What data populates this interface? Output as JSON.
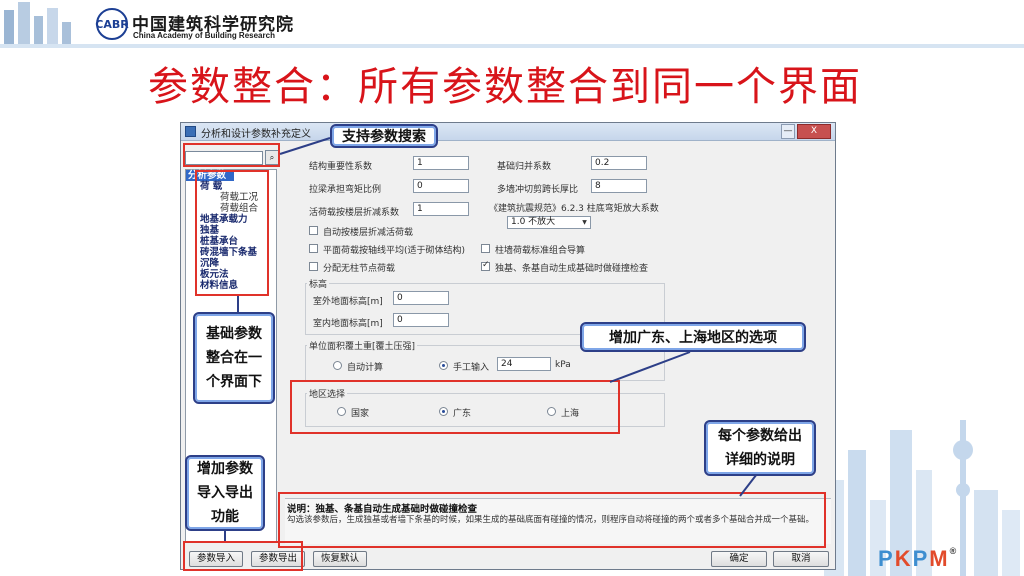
{
  "slide": {
    "org_cn": "中国建筑科学研究院",
    "org_en": "China Academy of Building Research",
    "logo": "CABR",
    "title": "参数整合：所有参数整合到同一个界面",
    "brand": "PKPM"
  },
  "window": {
    "title": "分析和设计参数补充定义",
    "close_label": "X",
    "minimize_label": "—"
  },
  "search": {
    "value": "",
    "button_icon": "magnifier"
  },
  "nav": [
    {
      "label": "分析参数",
      "type": "selected"
    },
    {
      "label": "荷  载",
      "type": "top"
    },
    {
      "label": "荷载工况",
      "type": "sub"
    },
    {
      "label": "荷载组合",
      "type": "sub"
    },
    {
      "label": "地基承载力",
      "type": "top"
    },
    {
      "label": "独基",
      "type": "top"
    },
    {
      "label": "桩基承台",
      "type": "top"
    },
    {
      "label": "砖混墙下条基",
      "type": "top"
    },
    {
      "label": "沉降",
      "type": "top"
    },
    {
      "label": "板元法",
      "type": "top"
    },
    {
      "label": "材料信息",
      "type": "top"
    }
  ],
  "params": {
    "struct_importance_label": "结构重要性系数",
    "struct_importance_value": "1",
    "base_reduction_label": "基础归并系数",
    "base_reduction_value": "0.2",
    "pile_slenderness_label": "拉梁承担弯矩比例",
    "pile_slenderness_value": "0",
    "multi_shear_label": "多墙冲切剪跨长厚比",
    "multi_shear_value": "8",
    "live_reduction_label": "活荷载按楼层折减系数",
    "live_reduction_value": "1",
    "seismic_note_label": "《建筑抗震规范》6.2.3 柱底弯矩放大系数",
    "seismic_select": "1.0   不放大",
    "chk_auto_floor_label": "自动按楼层折减活荷载",
    "chk_auto_floor_checked": false,
    "chk_level_label": "平面荷载按轴线平均(适于砌体结构)",
    "chk_level_checked": false,
    "chk_pile_cap_label": "柱墙荷载标准组合导算",
    "chk_pile_cap_checked": false,
    "chk_nonfloor_label": "分配无柱节点荷载",
    "chk_nonfloor_checked": false,
    "chk_auto_check_label": "独基、条基自动生成基础时做碰撞检查",
    "chk_auto_check_checked": true,
    "elev_group_label": "标高",
    "outdoor_elev_label": "室外地面标高[m]",
    "outdoor_elev_value": "0",
    "indoor_elev_label": "室内地面标高[m]",
    "indoor_elev_value": "0",
    "soil_group_label": "单位面积覆土重[覆土压强]",
    "soil_auto_label": "自动计算",
    "soil_auto_checked": false,
    "soil_manual_label": "手工输入",
    "soil_manual_checked": true,
    "soil_manual_value": "24",
    "soil_unit": "kPa",
    "region_group_label": "地区选择",
    "region_options": [
      {
        "label": "国家",
        "checked": false
      },
      {
        "label": "广东",
        "checked": true
      },
      {
        "label": "上海",
        "checked": false
      }
    ]
  },
  "description": {
    "title": "说明：独基、条基自动生成基础时做碰撞检查",
    "text": "勾选该参数后，生成独基或者墙下条基的时候，如果生成的基础底面有碰撞的情况，则程序自动将碰撞的两个或者多个基础合并成一个基础。"
  },
  "buttons": {
    "import": "参数导入",
    "export": "参数导出",
    "reset": "恢复默认",
    "ok": "确定",
    "cancel": "取消"
  },
  "annotations": {
    "search": "支持参数搜索",
    "base_merge_1": "基础参数",
    "base_merge_2": "整合在一",
    "base_merge_3": "个界面下",
    "region": "增加广东、上海地区的选项",
    "detail_1": "每个参数给出",
    "detail_2": "详细的说明",
    "io_1": "增加参数",
    "io_2": "导入导出",
    "io_3": "功能"
  },
  "colors": {
    "title_red": "#d8141a",
    "annotation_border": "#2d3f88",
    "annotation_rect": "#e0322a",
    "nav_text": "#1a2a6e"
  }
}
